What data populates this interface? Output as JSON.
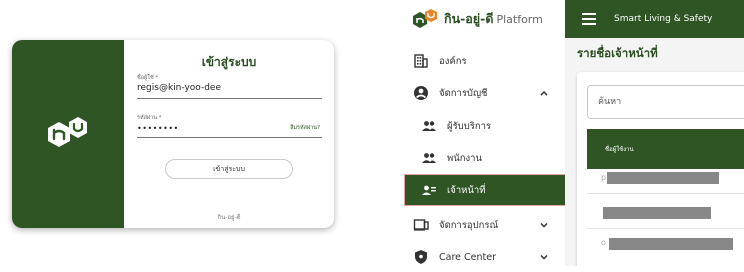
{
  "login": {
    "title": "เข้าสู่ระบบ",
    "username_label": "ชื่อผู้ใช้ *",
    "username_value": "regis@kin-yoo-dee",
    "password_label": "รหัสผ่าน *",
    "password_value": "••••••••",
    "forgot_label": "ลืมรหัสผ่าน?",
    "submit_label": "เข้าสู่ระบบ",
    "footer": "กิน-อยู่-ดี"
  },
  "sidebar": {
    "app_name": "กิน-อยู่-ดี",
    "app_suffix": "Platform",
    "items": [
      {
        "label": "องค์กร",
        "icon": "building-icon"
      },
      {
        "label": "จัดการบัญชี",
        "icon": "account-circle-icon",
        "expanded": true
      },
      {
        "label": "ผู้รับบริการ",
        "icon": "people-icon"
      },
      {
        "label": "พนักงาน",
        "icon": "people-icon"
      },
      {
        "label": "เจ้าหน้าที่",
        "icon": "staff-icon",
        "active": true
      },
      {
        "label": "จัดการอุปกรณ์",
        "icon": "device-icon"
      },
      {
        "label": "Care Center",
        "icon": "shield-icon"
      }
    ]
  },
  "topbar": {
    "title": "Smart Living & Safety"
  },
  "main": {
    "page_title": "รายชื่อเจ้าหน้าที่",
    "search_placeholder": "ค้นหา",
    "table_header": "ชื่อผู้ใช้งาน"
  },
  "colors": {
    "brand_green": "#2f5525",
    "active_outline": "#e8a6a6"
  }
}
